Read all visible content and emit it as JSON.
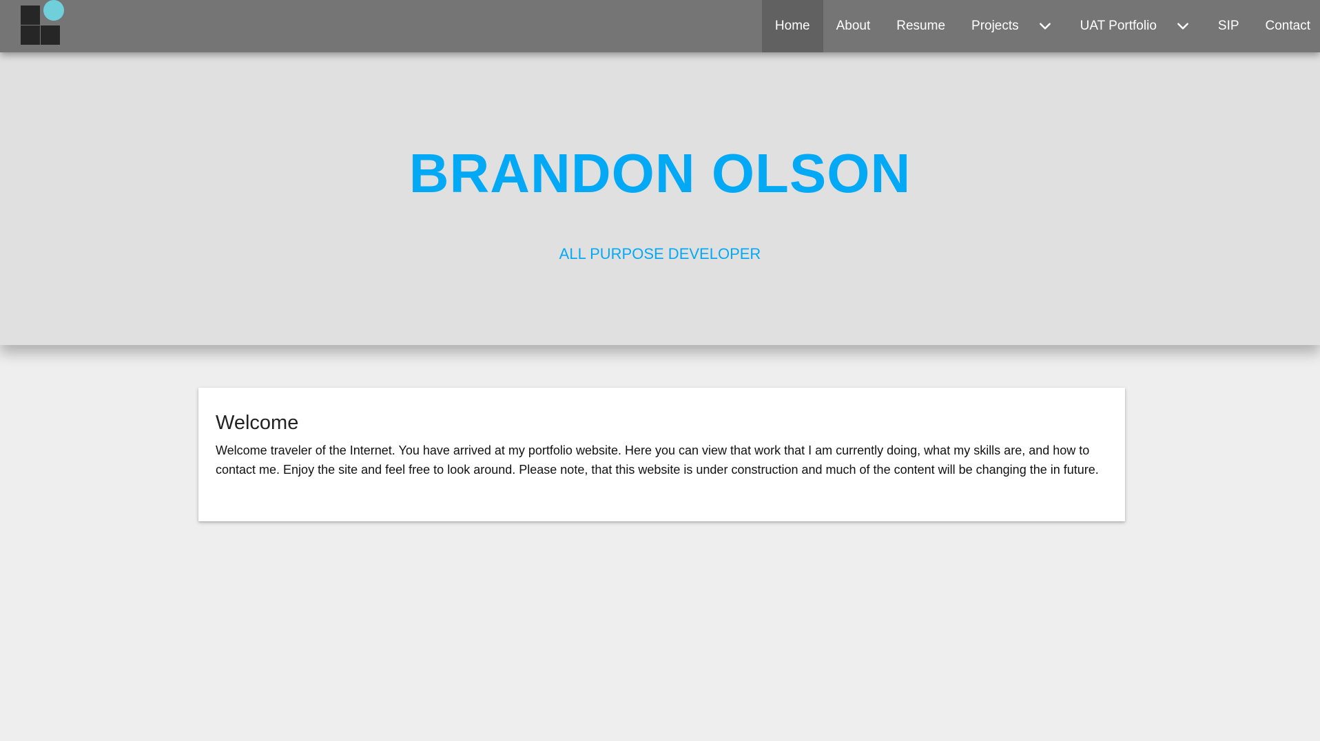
{
  "navbar": {
    "logo_name": "site-logo",
    "items": [
      {
        "label": "Home",
        "active": true
      },
      {
        "label": "About"
      },
      {
        "label": "Resume"
      },
      {
        "label": "Projects",
        "dropdown": true
      },
      {
        "label": "UAT Portfolio",
        "dropdown": true
      },
      {
        "label": "SIP"
      },
      {
        "label": "Contact"
      }
    ],
    "background": "#757575",
    "active_background": "#616161"
  },
  "hero": {
    "title": "BRANDON OLSON",
    "subtitle": "ALL PURPOSE DEVELOPER",
    "accent_color": "#03a9f4",
    "background": "#e0e0e0"
  },
  "welcome": {
    "title": "Welcome",
    "text": "Welcome traveler of the Internet. You have arrived at my portfolio website. Here you can view that work that I am currently doing, what my skills are, and how to contact me. Enjoy the site and feel free to look around. Please note, that this website is under construction and much of the content will be changing the in future."
  },
  "icons": {
    "dropdown": "chevron-down-icon"
  }
}
